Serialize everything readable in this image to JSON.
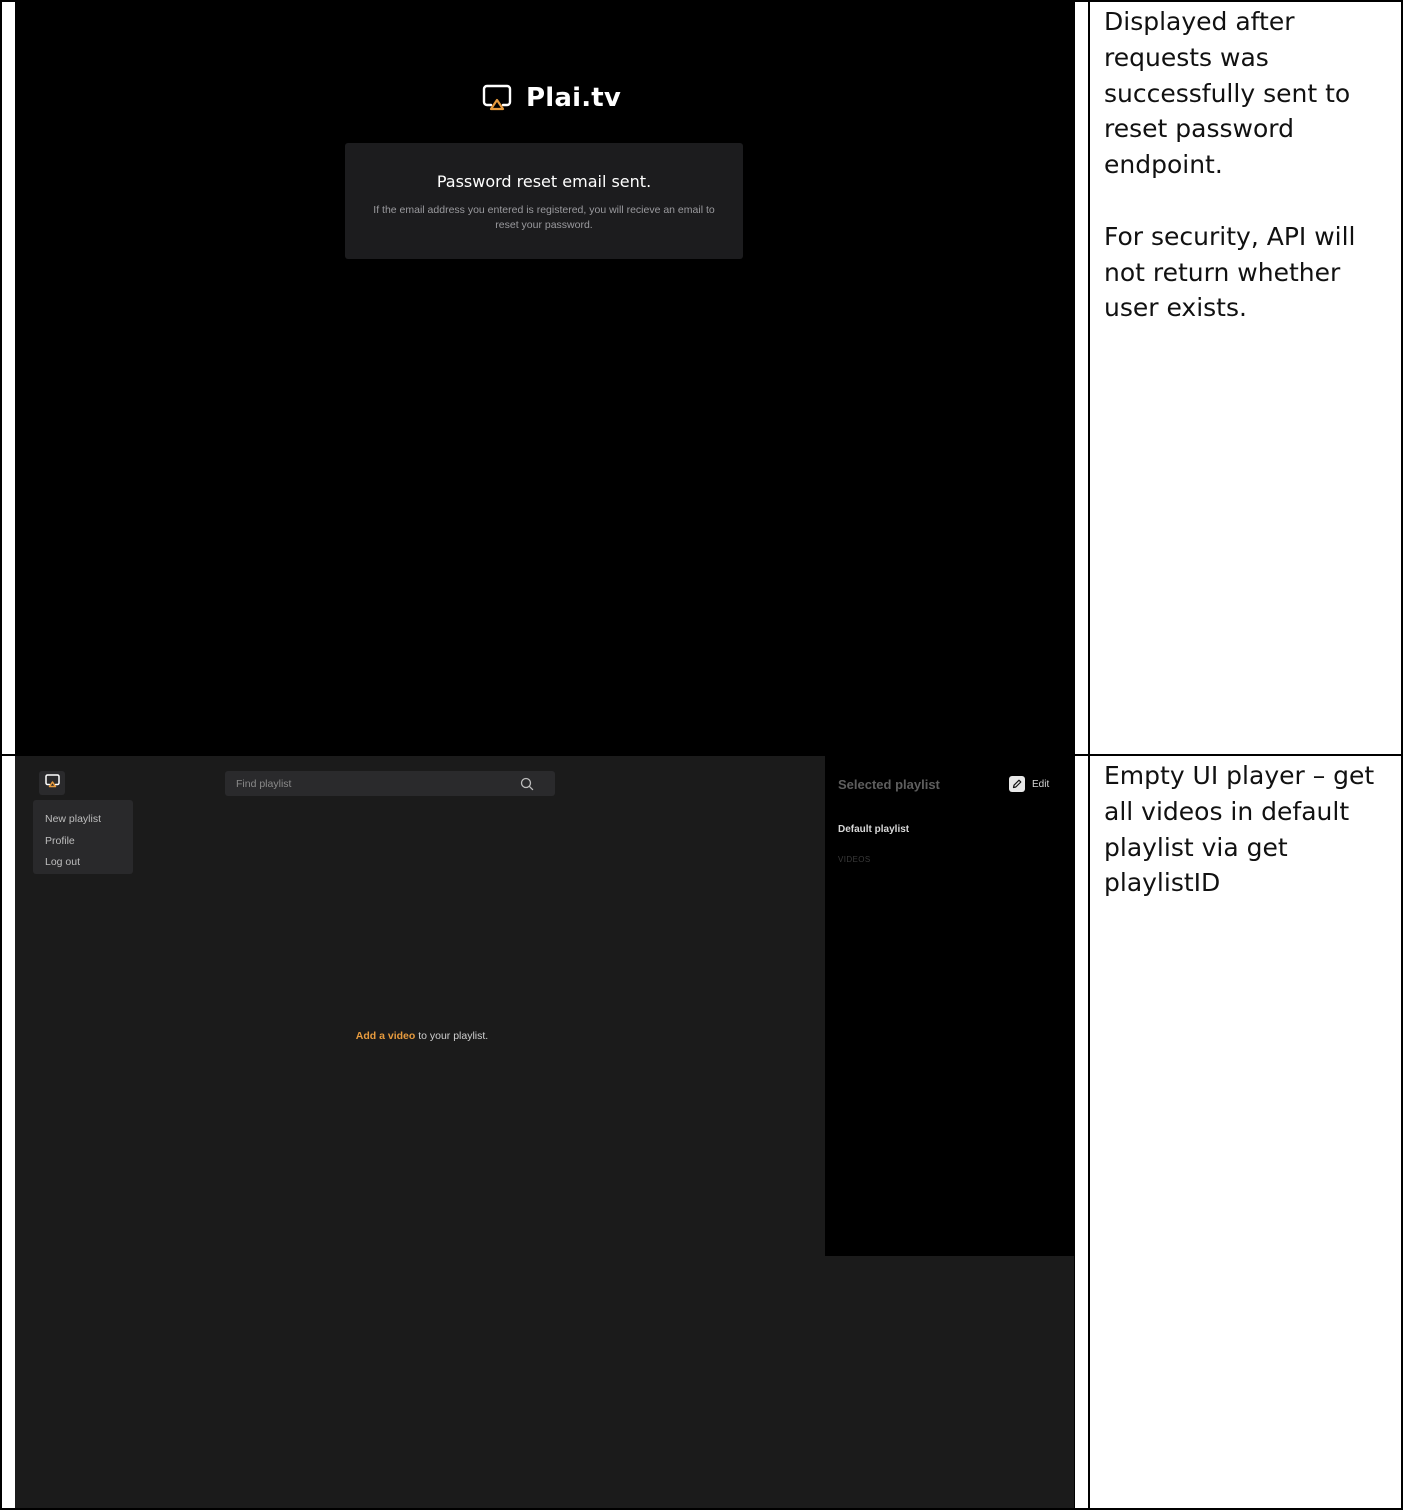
{
  "top_screen": {
    "brand": "Plai.tv",
    "card_title": "Password reset email sent.",
    "card_message": "If the email address you entered is registered, you will recieve an email to reset your password."
  },
  "bottom_screen": {
    "menu": [
      {
        "label": "New playlist"
      },
      {
        "label": "Profile"
      },
      {
        "label": "Log out"
      }
    ],
    "search_placeholder": "Find playlist",
    "empty_accent": "Add a video",
    "empty_rest": " to your playlist.",
    "sidebar": {
      "title": "Selected playlist",
      "edit_label": "Edit",
      "playlist_name": "Default playlist",
      "videos_label": "VIDEOS"
    }
  },
  "notes": {
    "top": "Displayed after requests was successfully sent to reset password endpoint.\n\nFor security, API will not return whether user exists.",
    "bottom": "Empty UI player – get all videos in default playlist via get playlistID"
  },
  "colors": {
    "accent": "#e79b3e",
    "background_dark": "#000000",
    "panel": "#1b1b1b"
  },
  "icons": [
    "plai-logo-icon",
    "search-icon",
    "edit-pencil-icon"
  ]
}
